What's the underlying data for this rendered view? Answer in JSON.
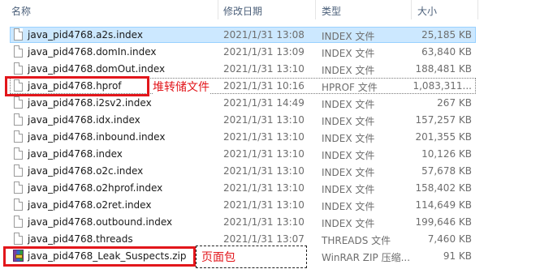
{
  "columns": {
    "name": "名称",
    "modified": "修改日期",
    "type": "类型",
    "size": "大小"
  },
  "files": [
    {
      "name": "java_pid4768.a2s.index",
      "modified": "2021/1/31 13:08",
      "type": "INDEX 文件",
      "size": "25,185 KB",
      "icon": "file-icon",
      "selected": true
    },
    {
      "name": "java_pid4768.domIn.index",
      "modified": "2021/1/31 13:09",
      "type": "INDEX 文件",
      "size": "63,840 KB",
      "icon": "file-icon"
    },
    {
      "name": "java_pid4768.domOut.index",
      "modified": "2021/1/31 13:10",
      "type": "INDEX 文件",
      "size": "188,481 KB",
      "icon": "file-icon"
    },
    {
      "name": "java_pid4768.hprof",
      "modified": "2021/1/31 10:16",
      "type": "HPROF 文件",
      "size": "1,083,311...",
      "icon": "file-icon",
      "focused": true
    },
    {
      "name": "java_pid4768.i2sv2.index",
      "modified": "2021/1/31 14:49",
      "type": "INDEX 文件",
      "size": "267 KB",
      "icon": "file-icon"
    },
    {
      "name": "java_pid4768.idx.index",
      "modified": "2021/1/31 13:10",
      "type": "INDEX 文件",
      "size": "157,257 KB",
      "icon": "file-icon"
    },
    {
      "name": "java_pid4768.inbound.index",
      "modified": "2021/1/31 13:10",
      "type": "INDEX 文件",
      "size": "201,355 KB",
      "icon": "file-icon"
    },
    {
      "name": "java_pid4768.index",
      "modified": "2021/1/31 13:10",
      "type": "INDEX 文件",
      "size": "10,126 KB",
      "icon": "file-icon"
    },
    {
      "name": "java_pid4768.o2c.index",
      "modified": "2021/1/31 13:10",
      "type": "INDEX 文件",
      "size": "57,678 KB",
      "icon": "file-icon"
    },
    {
      "name": "java_pid4768.o2hprof.index",
      "modified": "2021/1/31 13:10",
      "type": "INDEX 文件",
      "size": "158,402 KB",
      "icon": "file-icon"
    },
    {
      "name": "java_pid4768.o2ret.index",
      "modified": "2021/1/31 13:10",
      "type": "INDEX 文件",
      "size": "114,649 KB",
      "icon": "file-icon"
    },
    {
      "name": "java_pid4768.outbound.index",
      "modified": "2021/1/31 13:10",
      "type": "INDEX 文件",
      "size": "199,646 KB",
      "icon": "file-icon"
    },
    {
      "name": "java_pid4768.threads",
      "modified": "2021/1/31 13:07",
      "type": "THREADS 文件",
      "size": "7,460 KB",
      "icon": "file-icon"
    },
    {
      "name": "java_pid4768_Leak_Suspects.zip",
      "modified": "",
      "type": "WinRAR ZIP 压缩...",
      "size": "91 KB",
      "icon": "winrar-zip-icon"
    }
  ],
  "annotations": {
    "heap_dump": "堆转储文件",
    "page_package": "页面包"
  },
  "colors": {
    "annotation_red": "#e2161b",
    "selection_blue": "#cce8ff"
  }
}
